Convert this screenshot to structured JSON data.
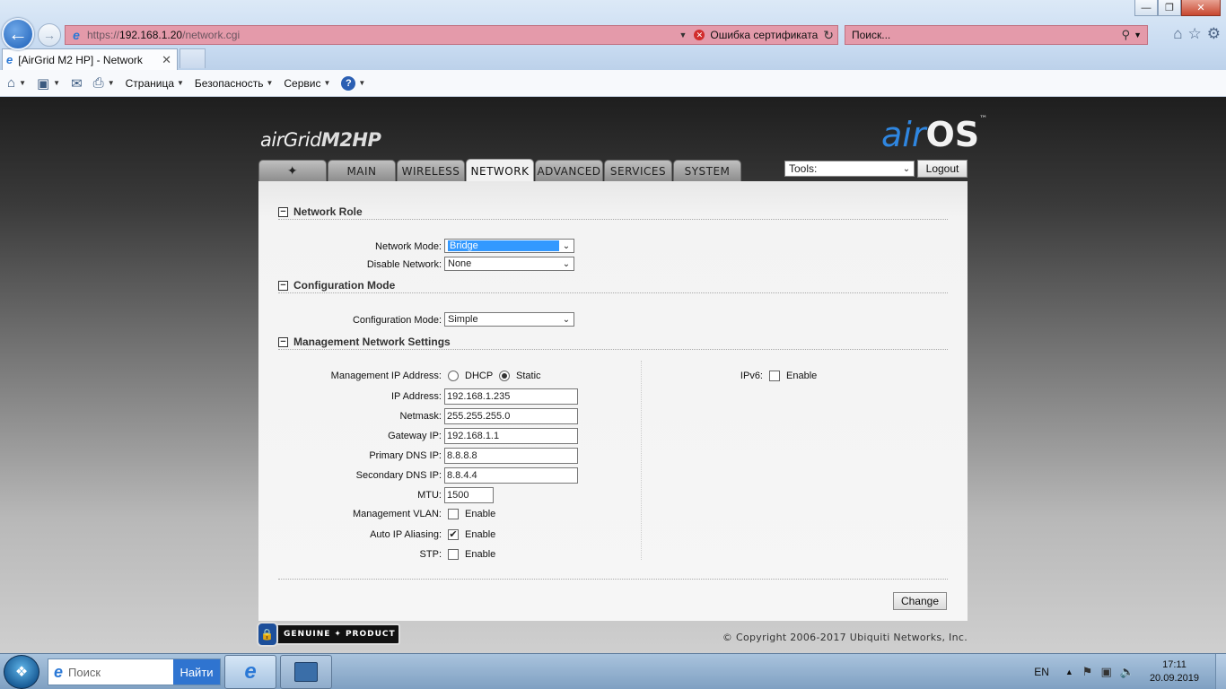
{
  "browser": {
    "url": {
      "protocol": "https://",
      "host": "192.168.1.20",
      "path": "/network.cgi"
    },
    "cert_error": "Ошибка сертификата",
    "search_placeholder": "Поиск...",
    "tab_title": "[AirGrid M2 HP] - Network",
    "commands": {
      "page": "Страница",
      "security": "Безопасность",
      "service": "Сервис"
    }
  },
  "device": {
    "brand_prefix": "airGrid",
    "brand_model": "M2HP",
    "os_air": "air",
    "os_os": "OS",
    "os_tm": "™"
  },
  "nav": {
    "tabs": [
      "MAIN",
      "WIRELESS",
      "NETWORK",
      "ADVANCED",
      "SERVICES",
      "SYSTEM"
    ],
    "active": "NETWORK",
    "tools_label": "Tools:",
    "logout": "Logout"
  },
  "network_role": {
    "title": "Network Role",
    "network_mode_label": "Network Mode:",
    "network_mode_value": "Bridge",
    "disable_network_label": "Disable Network:",
    "disable_network_value": "None"
  },
  "configuration": {
    "title": "Configuration Mode",
    "mode_label": "Configuration Mode:",
    "mode_value": "Simple"
  },
  "management": {
    "title": "Management Network Settings",
    "ip_mode_label": "Management IP Address:",
    "dhcp_label": "DHCP",
    "static_label": "Static",
    "ip_mode_selected": "Static",
    "ipv6_label": "IPv6:",
    "ipv6_enable": "Enable",
    "ip_label": "IP Address:",
    "ip_value": "192.168.1.235",
    "netmask_label": "Netmask:",
    "netmask_value": "255.255.255.0",
    "gateway_label": "Gateway IP:",
    "gateway_value": "192.168.1.1",
    "primary_dns_label": "Primary DNS IP:",
    "primary_dns_value": "8.8.8.8",
    "secondary_dns_label": "Secondary DNS IP:",
    "secondary_dns_value": "8.8.4.4",
    "mtu_label": "MTU:",
    "mtu_value": "1500",
    "vlan_label": "Management VLAN:",
    "vlan_enable": "Enable",
    "aliasing_label": "Auto IP Aliasing:",
    "aliasing_enable": "Enable",
    "aliasing_checked": true,
    "stp_label": "STP:",
    "stp_enable": "Enable",
    "change_button": "Change"
  },
  "footer": {
    "genuine_left": "GENUINE",
    "genuine_right": "PRODUCT",
    "copyright": "© Copyright 2006-2017 Ubiquiti Networks, Inc."
  },
  "taskbar": {
    "search_placeholder": "Поиск",
    "search_button": "Найти",
    "lang": "EN",
    "time": "17:11",
    "date": "20.09.2019"
  }
}
